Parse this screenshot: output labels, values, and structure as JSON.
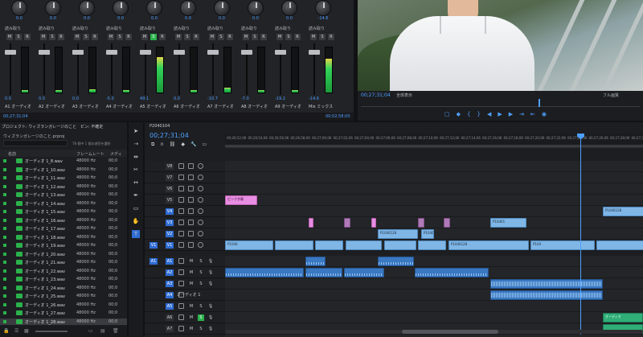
{
  "mixer": {
    "channels": [
      {
        "id": "A1",
        "knob": "0.0",
        "label": "読み取り",
        "db": "0.0",
        "name": "オーディオ"
      },
      {
        "id": "A2",
        "knob": "0.0",
        "label": "読み取り",
        "db": "0.0",
        "name": "オーディオ"
      },
      {
        "id": "A3",
        "knob": "0.0",
        "label": "読み取り",
        "db": "0.0",
        "name": "オーディオ"
      },
      {
        "id": "A4",
        "knob": "0.0",
        "label": "読み取り",
        "db": "-5.0",
        "name": "オーディオ"
      },
      {
        "id": "A5",
        "knob": "0.0",
        "label": "読み取り",
        "db": "49.1",
        "name": "オーディオ"
      },
      {
        "id": "A6",
        "knob": "0.0",
        "label": "読み取り",
        "db": "0.0",
        "name": "オーディオ"
      },
      {
        "id": "A7",
        "knob": "0.0",
        "label": "読み取り",
        "db": "-10.7",
        "name": "オーディオ"
      },
      {
        "id": "A8",
        "knob": "0.0",
        "label": "読み取り",
        "db": "-7.0",
        "name": "オーディオ"
      },
      {
        "id": "A9",
        "knob": "0.0",
        "label": "読み取り",
        "db": "-19.2",
        "name": "オーディオ"
      },
      {
        "id": "Mix",
        "knob": "-14.6",
        "label": "読み取り",
        "db": "-14.6",
        "name": "ミックス"
      }
    ],
    "timecode": "00;27;31;04",
    "end_timecode": "00;02;58;00"
  },
  "monitor": {
    "timecode": "00;27;31;04",
    "fit": "全体表示",
    "resolution": "フル画質"
  },
  "project": {
    "tab_title": "プロジェクト: ウィズランガレージのこと",
    "tab_bin": "ビン: 不確定",
    "file": "ウィズランガレージのこと.prproj",
    "item_count": "78 個中 1 個の項目を選択",
    "headers": {
      "name": "名前",
      "framerate": "フレームレート",
      "media": "メディ"
    },
    "items": [
      {
        "name": "オーディオ 1_8.wav",
        "rate": "48000 Hz",
        "dur": "00;0"
      },
      {
        "name": "オーディオ 1_10.wav",
        "rate": "48000 Hz",
        "dur": "00;0"
      },
      {
        "name": "オーディオ 1_11.wav",
        "rate": "48000 Hz",
        "dur": "00;0"
      },
      {
        "name": "オーディオ 1_12.wav",
        "rate": "48000 Hz",
        "dur": "00;0"
      },
      {
        "name": "オーディオ 1_13.wav",
        "rate": "48000 Hz",
        "dur": "00;0"
      },
      {
        "name": "オーディオ 1_14.wav",
        "rate": "48000 Hz",
        "dur": "00;0"
      },
      {
        "name": "オーディオ 1_15.wav",
        "rate": "48000 Hz",
        "dur": "00;0"
      },
      {
        "name": "オーディオ 1_16.wav",
        "rate": "48000 Hz",
        "dur": "00;0"
      },
      {
        "name": "オーディオ 1_17.wav",
        "rate": "48000 Hz",
        "dur": "00;0"
      },
      {
        "name": "オーディオ 1_18.wav",
        "rate": "48000 Hz",
        "dur": "00;0"
      },
      {
        "name": "オーディオ 1_19.wav",
        "rate": "48000 Hz",
        "dur": "00;0"
      },
      {
        "name": "オーディオ 1_20.wav",
        "rate": "48000 Hz",
        "dur": "00;0"
      },
      {
        "name": "オーディオ 1_21.wav",
        "rate": "48000 Hz",
        "dur": "00;0"
      },
      {
        "name": "オーディオ 1_22.wav",
        "rate": "48000 Hz",
        "dur": "00;0"
      },
      {
        "name": "オーディオ 1_23.wav",
        "rate": "48000 Hz",
        "dur": "00;0"
      },
      {
        "name": "オーディオ 1_24.wav",
        "rate": "48000 Hz",
        "dur": "00;0"
      },
      {
        "name": "オーディオ 1_25.wav",
        "rate": "48000 Hz",
        "dur": "00;0"
      },
      {
        "name": "オーディオ 1_26.wav",
        "rate": "48000 Hz",
        "dur": "00;0"
      },
      {
        "name": "オーディオ 1_27.wav",
        "rate": "48000 Hz",
        "dur": "00;0"
      },
      {
        "name": "オーディオ 1_28.wav",
        "rate": "48000 Hz",
        "dur": "00;0"
      }
    ]
  },
  "timeline": {
    "sequence": "P2040104",
    "timecode": "00;27;31;04",
    "ruler_labels": [
      "00;26;52;06",
      "00;26;54;06",
      "00;26;56;06",
      "00;26;58;06",
      "00;27;00;06",
      "00;27;02;06",
      "00;27;04;06",
      "00;27;06;06",
      "00;27;08;06",
      "00;27;10;06",
      "00;27;12;06",
      "00;27;14;06",
      "00;27;16;06",
      "00;27;18;06",
      "00;27;20;06",
      "00;27;22;06",
      "00;27;24;06",
      "00;27;26;06",
      "00;27;28;06",
      "00;27;30;06",
      "00;27;32;06",
      "00;27;34;06"
    ],
    "video_tracks": [
      "V8",
      "V7",
      "V6",
      "V5",
      "V4",
      "V3",
      "V2",
      "V1"
    ],
    "audio_tracks": [
      "A1",
      "A2",
      "A3",
      "A4",
      "A5",
      "A6",
      "A7",
      "A8"
    ],
    "audio4_name": "オーディオ 1",
    "clips": {
      "title": "ピンク字幕",
      "v1a": "P1040",
      "v1b": "P104",
      "v1c": "P1040128",
      "v2a": "P1040128",
      "v2b": "P1040115",
      "v4a": "P10401",
      "v4b": "P1040128",
      "green": "オーディオ"
    }
  }
}
